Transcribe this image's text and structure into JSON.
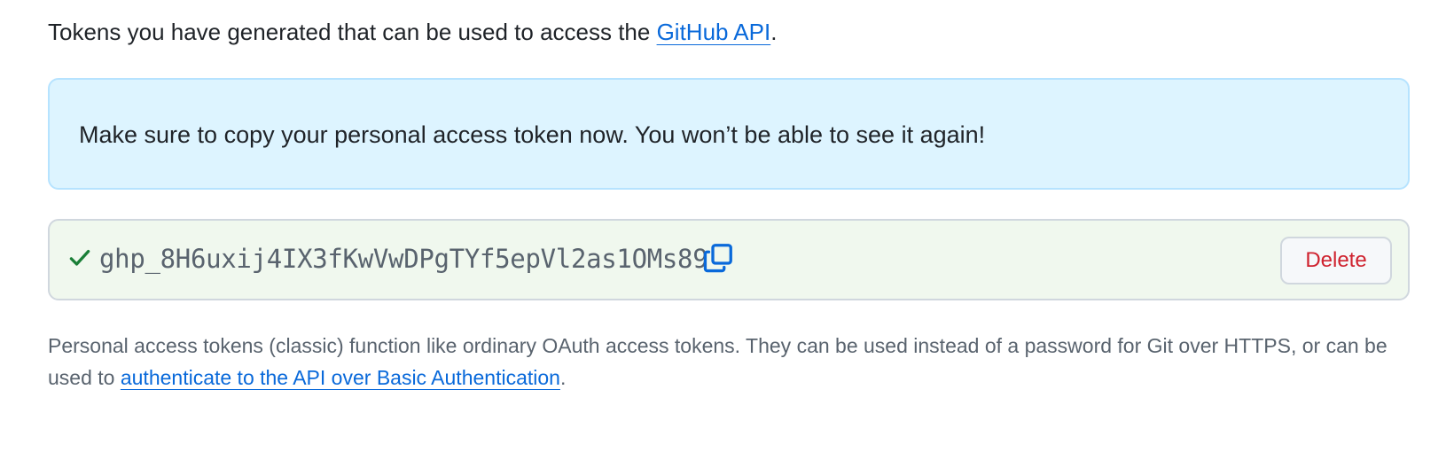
{
  "intro": {
    "text_before": "Tokens you have generated that can be used to access the ",
    "link_text": "GitHub API",
    "text_after": "."
  },
  "flash": {
    "message": "Make sure to copy your personal access token now. You won’t be able to see it again!"
  },
  "token": {
    "value": "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",
    "status_icon": "check-icon",
    "copy_icon": "copy-icon",
    "delete_label": "Delete"
  },
  "note": {
    "text_before": "Personal access tokens (classic) function like ordinary OAuth access tokens. They can be used instead of a password for Git over HTTPS, or can be used to ",
    "link_text": "authenticate to the API over Basic Authentication",
    "text_after": "."
  },
  "colors": {
    "link": "#0969da",
    "flash_bg": "#ddf4ff",
    "flash_border": "#b6e3ff",
    "token_bg": "#f0f8ee",
    "success": "#1a7f37",
    "danger": "#cf222e"
  }
}
